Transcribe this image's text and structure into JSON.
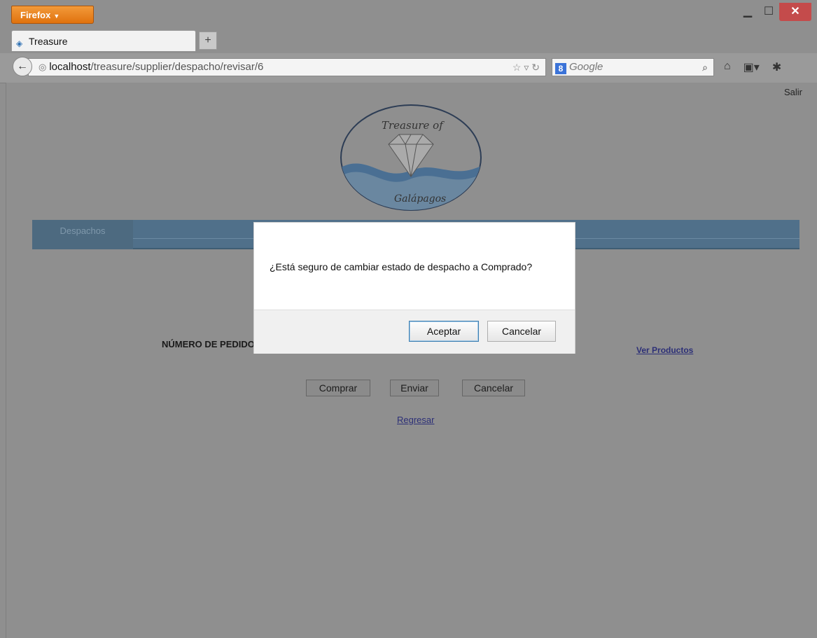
{
  "browser": {
    "menu_button": "Firefox",
    "tab_title": "Treasure",
    "new_tab_symbol": "+",
    "url_host": "localhost",
    "url_path": "/treasure/supplier/despacho/revisar/6",
    "search_engine": "Google",
    "window_controls": [
      "minimize",
      "maximize",
      "close"
    ]
  },
  "header": {
    "logout_link": "Salir",
    "logo_text_top": "Treasure of",
    "logo_text_bottom": "Galápagos"
  },
  "menu": {
    "items": [
      {
        "label": "Despachos"
      }
    ]
  },
  "main": {
    "order_number_label": "NÚMERO DE PEDIDO",
    "view_products_link": "Ver Productos",
    "buttons": {
      "buy": "Comprar",
      "send": "Enviar",
      "cancel": "Cancelar"
    },
    "back_link": "Regresar"
  },
  "dialog": {
    "message": "¿Está seguro de cambiar estado de despacho a Comprado?",
    "confirm_button": "Aceptar",
    "cancel_button": "Cancelar"
  },
  "colors": {
    "overlay": "#8f8f8f",
    "menu_bar": "#50708a",
    "firefox_button": "#e0720e",
    "close_button": "#c44b4b",
    "link": "#2c2f77"
  }
}
